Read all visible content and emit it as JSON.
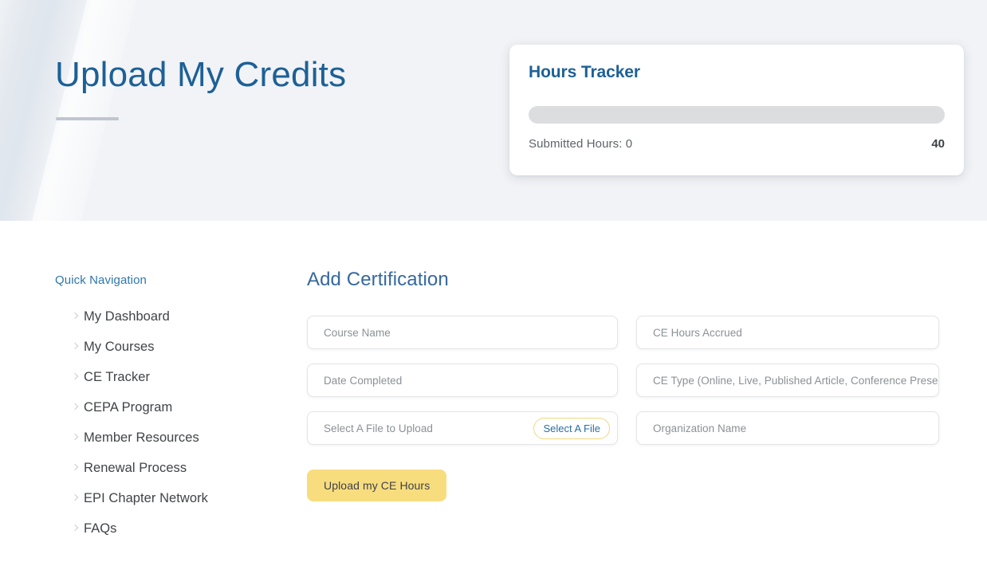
{
  "header": {
    "page_title": "Upload My Credits"
  },
  "tracker": {
    "title": "Hours Tracker",
    "submitted_label": "Submitted Hours: 0",
    "submitted_hours": 0,
    "goal_hours": "40",
    "progress_percent": 0,
    "track_color": "#dcdddf",
    "fill_color": "#1d6096"
  },
  "sidebar": {
    "heading": "Quick Navigation",
    "items": [
      {
        "label": "My Dashboard"
      },
      {
        "label": "My Courses"
      },
      {
        "label": "CE Tracker"
      },
      {
        "label": "CEPA Program"
      },
      {
        "label": "Member Resources"
      },
      {
        "label": "Renewal Process"
      },
      {
        "label": "EPI Chapter Network"
      },
      {
        "label": "FAQs"
      }
    ]
  },
  "form": {
    "heading": "Add Certification",
    "fields": {
      "course_name": {
        "placeholder": "Course Name",
        "value": ""
      },
      "ce_hours_accrued": {
        "placeholder": "CE Hours Accrued",
        "value": ""
      },
      "date_completed": {
        "placeholder": "Date Completed",
        "value": ""
      },
      "ce_type": {
        "placeholder": "CE Type (Online, Live, Published Article, Conference Presenter, etc.)",
        "value": ""
      },
      "file_upload": {
        "placeholder": "Select A File to Upload",
        "value": ""
      },
      "organization_name": {
        "placeholder": "Organization Name",
        "value": ""
      }
    },
    "select_file_label": "Select A File",
    "submit_label": "Upload my CE Hours"
  },
  "colors": {
    "brand_blue": "#1d6096",
    "heading_blue": "#35689f",
    "accent_yellow": "#f8dd7f",
    "header_band": "#f1f3f6"
  }
}
